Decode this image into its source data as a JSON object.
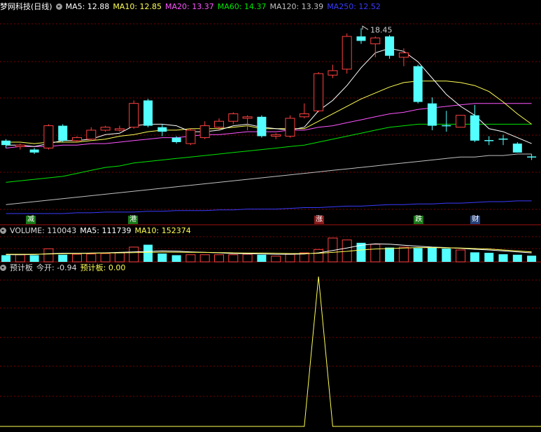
{
  "header_main": {
    "title": "梦网科技(日线)",
    "ma5": "MA5: 12.88",
    "ma10": "MA10: 12.85",
    "ma20": "MA20: 13.37",
    "ma60": "MA60: 14.37",
    "ma120": "MA120: 13.39",
    "ma250": "MA250: 12.52"
  },
  "header_volume": {
    "title": "VOLUME: 110043",
    "ma5": "MA5: 111739",
    "ma10": "MA10: 152374"
  },
  "header_indicator": {
    "title": "预计板",
    "jinkai": "今开: -0.94",
    "yujiban": "预计板: 0.00"
  },
  "high_label": "18.45",
  "markers": [
    {
      "text": "减",
      "color": "#1a7a1a"
    },
    {
      "text": "港",
      "color": "#1a7a1a"
    },
    {
      "text": "涨",
      "color": "#8a1a1a"
    },
    {
      "text": "跌",
      "color": "#1a7a1a"
    },
    {
      "text": "财",
      "color": "#24407a"
    }
  ],
  "colors": {
    "up": "#ff4040",
    "down": "#54ffff",
    "ma5": "#ffffff",
    "ma10": "#ffff54",
    "ma20": "#ff54ff",
    "ma60": "#00e600",
    "ma120": "#c0c0c0",
    "ma250": "#3a3aff",
    "grid": "#7a0000",
    "separator": "#a01010"
  },
  "chart_data": {
    "type": "candlestick",
    "candles": [
      {
        "o": 10.9,
        "c": 10.6,
        "h": 11.0,
        "l": 10.4
      },
      {
        "o": 10.5,
        "c": 10.6,
        "h": 10.7,
        "l": 10.3
      },
      {
        "o": 10.3,
        "c": 10.1,
        "h": 10.4,
        "l": 10.0
      },
      {
        "o": 10.4,
        "c": 11.9,
        "h": 12.0,
        "l": 10.3
      },
      {
        "o": 11.9,
        "c": 10.9,
        "h": 12.0,
        "l": 10.8
      },
      {
        "o": 10.9,
        "c": 11.1,
        "h": 11.2,
        "l": 10.8
      },
      {
        "o": 11.0,
        "c": 11.6,
        "h": 11.8,
        "l": 10.9
      },
      {
        "o": 11.6,
        "c": 11.8,
        "h": 11.9,
        "l": 11.5
      },
      {
        "o": 11.6,
        "c": 11.7,
        "h": 11.9,
        "l": 11.5
      },
      {
        "o": 11.8,
        "c": 13.4,
        "h": 13.6,
        "l": 11.7
      },
      {
        "o": 13.6,
        "c": 11.9,
        "h": 13.7,
        "l": 11.8
      },
      {
        "o": 11.8,
        "c": 11.5,
        "h": 12.0,
        "l": 11.2
      },
      {
        "o": 11.1,
        "c": 10.8,
        "h": 11.2,
        "l": 10.7
      },
      {
        "o": 10.7,
        "c": 11.6,
        "h": 11.7,
        "l": 10.6
      },
      {
        "o": 11.1,
        "c": 11.9,
        "h": 12.2,
        "l": 11.0
      },
      {
        "o": 11.8,
        "c": 12.2,
        "h": 12.4,
        "l": 11.6
      },
      {
        "o": 12.2,
        "c": 12.7,
        "h": 12.8,
        "l": 12.0
      },
      {
        "o": 12.4,
        "c": 12.5,
        "h": 12.6,
        "l": 11.6
      },
      {
        "o": 12.5,
        "c": 11.2,
        "h": 12.6,
        "l": 11.1
      },
      {
        "o": 11.2,
        "c": 11.3,
        "h": 11.4,
        "l": 11.0
      },
      {
        "o": 11.2,
        "c": 12.4,
        "h": 12.6,
        "l": 11.1
      },
      {
        "o": 12.5,
        "c": 12.7,
        "h": 13.4,
        "l": 12.4
      },
      {
        "o": 12.9,
        "c": 15.4,
        "h": 15.5,
        "l": 12.8
      },
      {
        "o": 15.3,
        "c": 15.6,
        "h": 16.0,
        "l": 15.1
      },
      {
        "o": 15.7,
        "c": 17.9,
        "h": 18.1,
        "l": 15.4
      },
      {
        "o": 17.9,
        "c": 17.6,
        "h": 18.45,
        "l": 17.4
      },
      {
        "o": 17.4,
        "c": 17.8,
        "h": 17.9,
        "l": 16.5
      },
      {
        "o": 17.9,
        "c": 16.6,
        "h": 18.0,
        "l": 16.4
      },
      {
        "o": 16.5,
        "c": 16.8,
        "h": 17.1,
        "l": 15.9
      },
      {
        "o": 15.9,
        "c": 13.5,
        "h": 16.0,
        "l": 13.4
      },
      {
        "o": 13.4,
        "c": 11.9,
        "h": 13.8,
        "l": 11.6
      },
      {
        "o": 11.9,
        "c": 11.9,
        "h": 12.9,
        "l": 11.5
      },
      {
        "o": 11.8,
        "c": 12.6,
        "h": 12.6,
        "l": 11.8
      },
      {
        "o": 12.6,
        "c": 10.9,
        "h": 13.3,
        "l": 10.8
      },
      {
        "o": 10.9,
        "c": 10.9,
        "h": 11.2,
        "l": 10.6
      },
      {
        "o": 11.0,
        "c": 11.0,
        "h": 11.3,
        "l": 10.6
      },
      {
        "o": 10.7,
        "c": 10.1,
        "h": 10.8,
        "l": 10.1
      },
      {
        "o": 9.8,
        "c": 9.8,
        "h": 10.0,
        "l": 9.6
      }
    ],
    "ma5": [
      10.6,
      10.6,
      10.5,
      10.7,
      10.9,
      10.9,
      11.0,
      11.3,
      11.4,
      11.9,
      12.0,
      12.0,
      11.9,
      11.5,
      11.5,
      11.6,
      11.9,
      12.0,
      11.8,
      11.7,
      11.6,
      11.8,
      12.9,
      13.6,
      14.6,
      15.8,
      16.8,
      17.1,
      16.9,
      16.2,
      15.1,
      14.0,
      13.2,
      12.6,
      11.7,
      11.5,
      11.1,
      10.7
    ],
    "ma10": [
      10.8,
      10.8,
      10.7,
      10.8,
      10.8,
      10.8,
      10.9,
      11.0,
      11.2,
      11.3,
      11.5,
      11.6,
      11.6,
      11.7,
      11.7,
      11.7,
      11.8,
      11.9,
      11.7,
      11.7,
      11.7,
      11.7,
      12.2,
      12.7,
      13.2,
      13.7,
      14.1,
      14.5,
      14.8,
      14.9,
      14.9,
      14.9,
      14.8,
      14.6,
      14.2,
      13.5,
      12.7,
      12.0
    ],
    "ma20": [
      10.4,
      10.5,
      10.5,
      10.5,
      10.6,
      10.6,
      10.7,
      10.7,
      10.8,
      10.9,
      11.0,
      11.1,
      11.1,
      11.2,
      11.3,
      11.3,
      11.4,
      11.5,
      11.5,
      11.5,
      11.6,
      11.6,
      11.8,
      11.9,
      12.1,
      12.3,
      12.5,
      12.7,
      12.8,
      13.0,
      13.1,
      13.2,
      13.3,
      13.4,
      13.4,
      13.4,
      13.4,
      13.4
    ],
    "ma60": [
      8.1,
      8.2,
      8.3,
      8.4,
      8.5,
      8.7,
      8.9,
      9.1,
      9.2,
      9.4,
      9.5,
      9.6,
      9.7,
      9.8,
      9.9,
      10.0,
      10.1,
      10.2,
      10.3,
      10.4,
      10.5,
      10.6,
      10.8,
      11.0,
      11.2,
      11.4,
      11.6,
      11.8,
      11.9,
      12.0,
      12.0,
      12.0,
      12.0,
      12.0,
      12.0,
      12.0,
      12.0,
      12.0
    ],
    "ma120": [
      6.6,
      6.7,
      6.8,
      6.9,
      7.0,
      7.1,
      7.2,
      7.3,
      7.4,
      7.5,
      7.6,
      7.7,
      7.8,
      7.9,
      8.0,
      8.1,
      8.2,
      8.3,
      8.4,
      8.5,
      8.6,
      8.7,
      8.8,
      8.9,
      9.0,
      9.1,
      9.2,
      9.3,
      9.4,
      9.5,
      9.6,
      9.7,
      9.8,
      9.8,
      9.9,
      9.9,
      10.0,
      10.0
    ],
    "ma250": [
      6.0,
      6.0,
      6.0,
      6.0,
      6.0,
      6.05,
      6.05,
      6.1,
      6.1,
      6.1,
      6.15,
      6.15,
      6.2,
      6.2,
      6.2,
      6.25,
      6.25,
      6.3,
      6.3,
      6.3,
      6.35,
      6.4,
      6.4,
      6.45,
      6.5,
      6.5,
      6.55,
      6.6,
      6.6,
      6.65,
      6.65,
      6.7,
      6.7,
      6.75,
      6.8,
      6.8,
      6.85,
      6.85
    ],
    "ylim": [
      6.0,
      19.5
    ],
    "volume": [
      0.28,
      0.3,
      0.28,
      0.55,
      0.3,
      0.32,
      0.33,
      0.35,
      0.38,
      0.62,
      0.72,
      0.35,
      0.28,
      0.3,
      0.3,
      0.3,
      0.3,
      0.32,
      0.3,
      0.24,
      0.32,
      0.38,
      0.52,
      1.0,
      0.92,
      0.8,
      0.74,
      0.6,
      0.62,
      0.58,
      0.6,
      0.56,
      0.5,
      0.4,
      0.38,
      0.32,
      0.3,
      0.26
    ],
    "volume_ma5": [
      0.3,
      0.3,
      0.31,
      0.34,
      0.36,
      0.36,
      0.37,
      0.38,
      0.4,
      0.42,
      0.44,
      0.46,
      0.45,
      0.42,
      0.4,
      0.38,
      0.35,
      0.34,
      0.33,
      0.32,
      0.32,
      0.33,
      0.38,
      0.48,
      0.58,
      0.7,
      0.76,
      0.74,
      0.7,
      0.66,
      0.62,
      0.6,
      0.57,
      0.53,
      0.5,
      0.46,
      0.42,
      0.38
    ],
    "volume_ma10": [
      0.32,
      0.32,
      0.32,
      0.33,
      0.34,
      0.35,
      0.36,
      0.37,
      0.38,
      0.39,
      0.4,
      0.41,
      0.41,
      0.4,
      0.4,
      0.39,
      0.38,
      0.37,
      0.37,
      0.36,
      0.35,
      0.35,
      0.36,
      0.4,
      0.44,
      0.5,
      0.54,
      0.56,
      0.58,
      0.6,
      0.6,
      0.59,
      0.58,
      0.56,
      0.54,
      0.5,
      0.46,
      0.42
    ],
    "indicator": [
      0,
      0,
      0,
      0,
      0,
      0,
      0,
      0,
      0,
      0,
      0,
      0,
      0,
      0,
      0,
      0,
      0,
      0,
      0,
      0,
      0,
      0,
      1,
      0,
      0,
      0,
      0,
      0,
      0,
      0,
      0,
      0,
      0,
      0,
      0,
      0,
      0,
      0
    ]
  }
}
